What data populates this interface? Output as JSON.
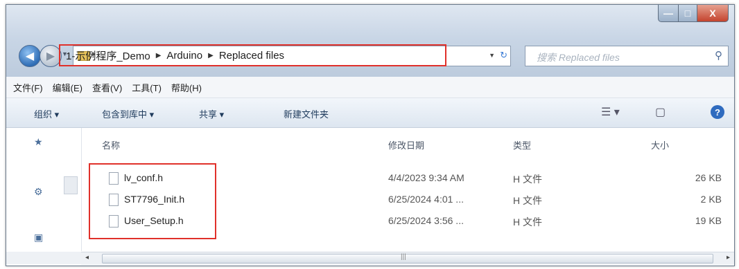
{
  "window": {
    "buttons": {
      "minimize": "—",
      "maximize": "□",
      "close": "X"
    }
  },
  "address": {
    "crumbs": [
      "1-示例程序_Demo",
      "Arduino",
      "Replaced files"
    ]
  },
  "search": {
    "placeholder": "搜索 Replaced files"
  },
  "menu": [
    "文件(F)",
    "编辑(E)",
    "查看(V)",
    "工具(T)",
    "帮助(H)"
  ],
  "toolbar": {
    "organize": "组织 ▾",
    "include_library": "包含到库中 ▾",
    "share": "共享 ▾",
    "new_folder": "新建文件夹",
    "help": "?"
  },
  "columns": {
    "name": "名称",
    "date": "修改日期",
    "type": "类型",
    "size": "大小"
  },
  "files": [
    {
      "name": "lv_conf.h",
      "date": "4/4/2023 9:34 AM",
      "type": "H 文件",
      "size": "26 KB"
    },
    {
      "name": "ST7796_Init.h",
      "date": "6/25/2024 4:01 ...",
      "type": "H 文件",
      "size": "2 KB"
    },
    {
      "name": "User_Setup.h",
      "date": "6/25/2024 3:56 ...",
      "type": "H 文件",
      "size": "19 KB"
    }
  ],
  "colors": {
    "highlight": "#e0302a",
    "accent": "#2f6bbf"
  }
}
